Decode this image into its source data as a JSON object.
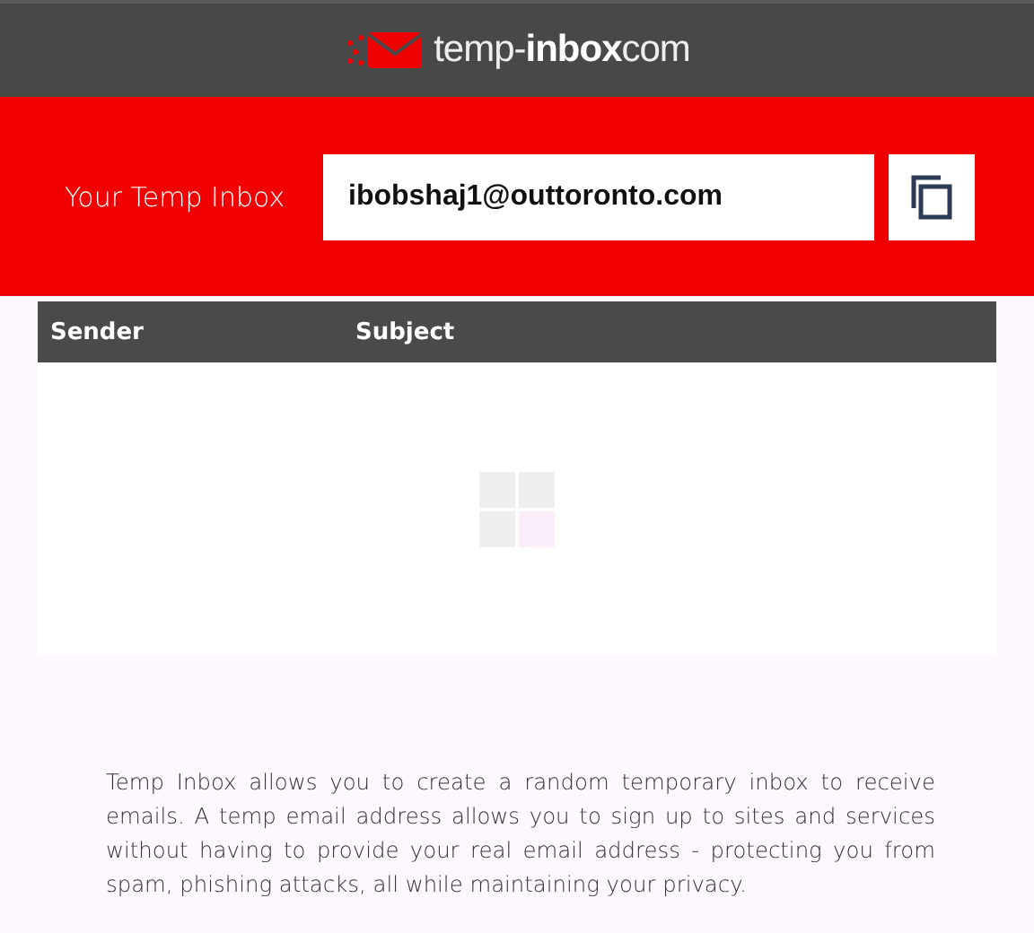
{
  "header": {
    "logo": "temp-**inbox**com"
  },
  "inbox": {
    "label": "Your Temp Inbox",
    "address": "ibobshaj1@outtoronto.com"
  },
  "table": {
    "columns": [
      "Sender",
      "Subject"
    ]
  },
  "description": "Temp Inbox allows you to create a random temporary inbox to receive emails. A temp email address allows you to sign up to sites and services without having to provide your real email address - protecting you from spam, phishing attacks, all while maintaining your privacy."
}
